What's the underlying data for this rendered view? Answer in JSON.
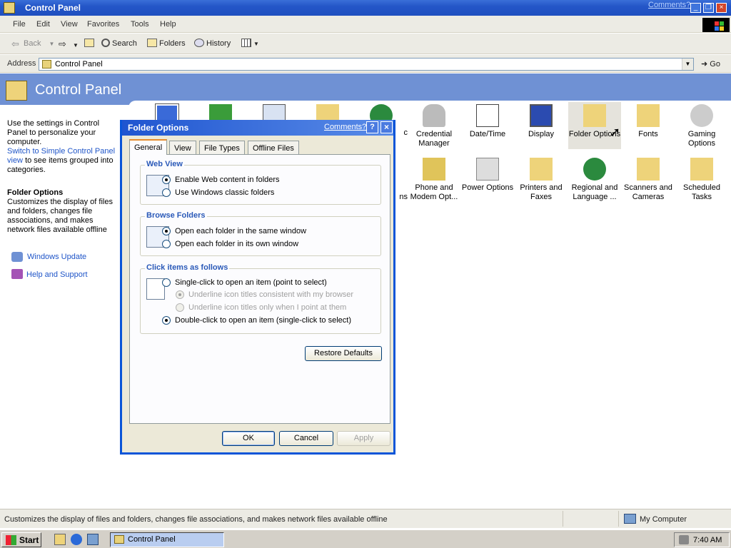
{
  "window": {
    "title": "Control Panel",
    "comments_link": "Comments?"
  },
  "menu": [
    "File",
    "Edit",
    "View",
    "Favorites",
    "Tools",
    "Help"
  ],
  "toolbar": {
    "back": "Back",
    "search": "Search",
    "folders": "Folders",
    "history": "History"
  },
  "address": {
    "label": "Address",
    "value": "Control Panel",
    "go": "Go"
  },
  "header": {
    "title": "Control Panel"
  },
  "left_pane": {
    "intro": "Use the settings in Control Panel to personalize your computer.",
    "switch_link": "Switch to Simple Control Panel view",
    "switch_rest": "to see items grouped into categories.",
    "detail_title": "Folder Options",
    "detail_text": "Customizes the display of files and folders, changes file associations, and makes network files available offline",
    "links": [
      "Windows Update",
      "Help and Support"
    ]
  },
  "icons": [
    {
      "label": "Credential Manager",
      "icon": "credential-icon"
    },
    {
      "label": "Date/Time",
      "icon": "calendar-clock-icon"
    },
    {
      "label": "Display",
      "icon": "monitor-icon"
    },
    {
      "label": "Folder Options",
      "icon": "folder-options-icon",
      "selected": true
    },
    {
      "label": "Fonts",
      "icon": "fonts-folder-icon"
    },
    {
      "label": "Gaming Options",
      "icon": "joystick-icon"
    },
    {
      "label": "Phone and Modem Opt...",
      "icon": "phone-icon"
    },
    {
      "label": "Power Options",
      "icon": "power-icon"
    },
    {
      "label": "Printers and Faxes",
      "icon": "printer-folder-icon"
    },
    {
      "label": "Regional and Language ...",
      "icon": "globe-icon"
    },
    {
      "label": "Scanners and Cameras",
      "icon": "scanner-icon"
    },
    {
      "label": "Scheduled Tasks",
      "icon": "scheduled-tasks-icon"
    }
  ],
  "partial_labels": {
    "c": "c",
    "ns": "ns"
  },
  "dialog": {
    "title": "Folder Options",
    "comments": "Comments?",
    "help_btn": "?",
    "close_btn": "×",
    "tabs": [
      "General",
      "View",
      "File Types",
      "Offline Files"
    ],
    "web_view": {
      "label": "Web View",
      "options": [
        "Enable Web content in folders",
        "Use Windows classic folders"
      ],
      "selected": 0
    },
    "browse": {
      "label": "Browse Folders",
      "options": [
        "Open each folder in the same window",
        "Open each folder in its own window"
      ],
      "selected": 0
    },
    "click": {
      "label": "Click items as follows",
      "single": "Single-click to open an item (point to select)",
      "sub1": "Underline icon titles consistent with my browser",
      "sub2": "Underline icon titles only when I point at them",
      "double": "Double-click to open an item (single-click to select)"
    },
    "restore": "Restore Defaults",
    "ok": "OK",
    "cancel": "Cancel",
    "apply": "Apply"
  },
  "status": {
    "text": "Customizes the display of files and folders, changes file associations, and makes network files available offline",
    "zone": "My Computer"
  },
  "taskbar": {
    "start": "Start",
    "task": "Control Panel",
    "time": "7:40 AM"
  },
  "colors": {
    "title_blue": "#2456c8",
    "header_band": "#6f91d4",
    "link": "#1f55c8",
    "group_label": "#2a59b8"
  }
}
